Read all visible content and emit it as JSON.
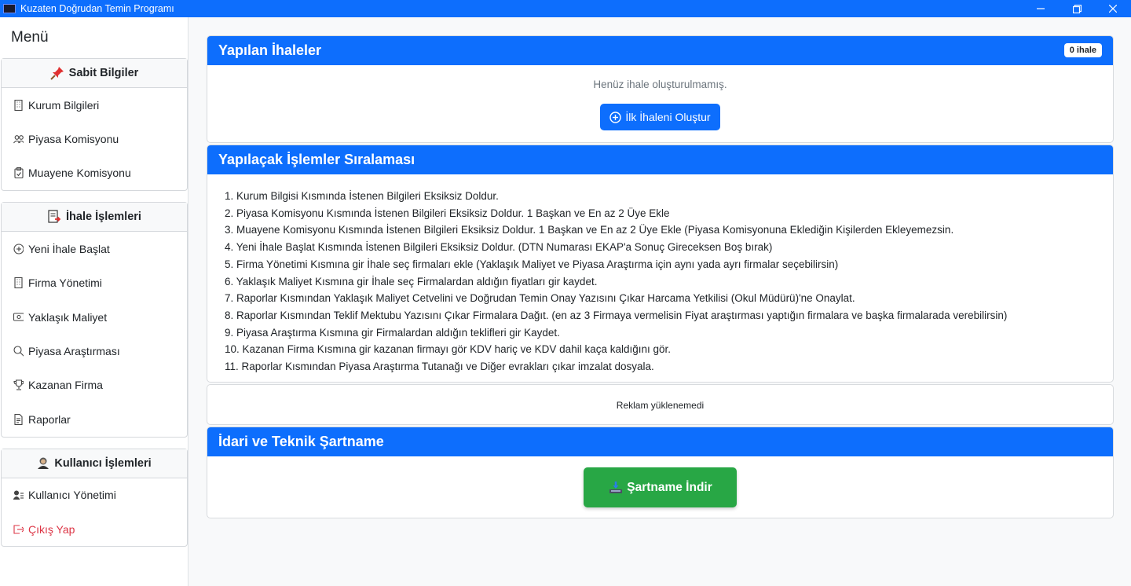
{
  "window": {
    "title": "Kuzaten Doğrudan Temin Programı"
  },
  "sidebar": {
    "menu_title": "Menü",
    "groups": [
      {
        "title": "Sabit Bilgiler",
        "items": [
          {
            "label": "Kurum Bilgileri",
            "icon": "building-icon"
          },
          {
            "label": "Piyasa Komisyonu",
            "icon": "people-icon"
          },
          {
            "label": "Muayene Komisyonu",
            "icon": "clipboard-icon"
          }
        ]
      },
      {
        "title": "İhale İşlemleri",
        "items": [
          {
            "label": "Yeni İhale Başlat",
            "icon": "plus-circle-icon"
          },
          {
            "label": "Firma Yönetimi",
            "icon": "building-icon"
          },
          {
            "label": "Yaklaşık Maliyet",
            "icon": "cash-icon"
          },
          {
            "label": "Piyasa Araştırması",
            "icon": "search-icon"
          },
          {
            "label": "Kazanan Firma",
            "icon": "trophy-icon"
          },
          {
            "label": "Raporlar",
            "icon": "document-icon"
          }
        ]
      },
      {
        "title": "Kullanıcı İşlemleri",
        "items": [
          {
            "label": "Kullanıcı Yönetimi",
            "icon": "person-lines-icon"
          },
          {
            "label": "Çıkış Yap",
            "icon": "logout-icon"
          }
        ]
      }
    ]
  },
  "tenders": {
    "title": "Yapılan İhaleler",
    "count_badge": "0 ihale",
    "empty_message": "Henüz ihale oluşturulmamış.",
    "create_button": "İlk İhaleni Oluştur"
  },
  "steps": {
    "title": "Yapılaçak İşlemler Sıralaması",
    "items": [
      "1. Kurum Bilgisi Kısmında İstenen Bilgileri Eksiksiz Doldur.",
      "2. Piyasa Komisyonu Kısmında İstenen Bilgileri Eksiksiz Doldur. 1 Başkan ve En az 2 Üye Ekle",
      "3. Muayene Komisyonu Kısmında İstenen Bilgileri Eksiksiz Doldur. 1 Başkan ve En az 2 Üye Ekle (Piyasa Komisyonuna Eklediğin Kişilerden Ekleyemezsin.",
      "4. Yeni İhale Başlat Kısmında İstenen Bilgileri Eksiksiz Doldur. (DTN Numarası EKAP'a Sonuç Gireceksen Boş bırak)",
      "5. Firma Yönetimi Kısmına gir İhale seç firmaları ekle (Yaklaşık Maliyet ve Piyasa Araştırma için aynı yada ayrı firmalar seçebilirsin)",
      "6. Yaklaşık Maliyet Kısmına gir İhale seç Firmalardan aldığın fiyatları gir kaydet.",
      "7. Raporlar Kısmından Yaklaşık Maliyet Cetvelini ve Doğrudan Temin Onay Yazısını Çıkar Harcama Yetkilisi (Okul Müdürü)'ne Onaylat.",
      "8. Raporlar Kısmından Teklif Mektubu Yazısını Çıkar Firmalara Dağıt. (en az 3 Firmaya vermelisin Fiyat araştırması yaptığın firmalara ve başka firmalarada verebilirsin)",
      "9. Piyasa Araştırma Kısmına gir Firmalardan aldığın teklifleri gir Kaydet.",
      "10. Kazanan Firma Kısmına gir kazanan firmayı gör KDV hariç ve KDV dahil kaça kaldığını gör.",
      "11. Raporlar Kısmından Piyasa Araştırma Tutanağı ve Diğer evrakları çıkar imzalat dosyala."
    ]
  },
  "ad": {
    "message": "Reklam yüklenemedi"
  },
  "spec": {
    "title": "İdari ve Teknik Şartname",
    "download_button": "Şartname İndir"
  },
  "colors": {
    "primary": "#0d6efd",
    "success": "#28a745",
    "danger": "#dc3545"
  }
}
